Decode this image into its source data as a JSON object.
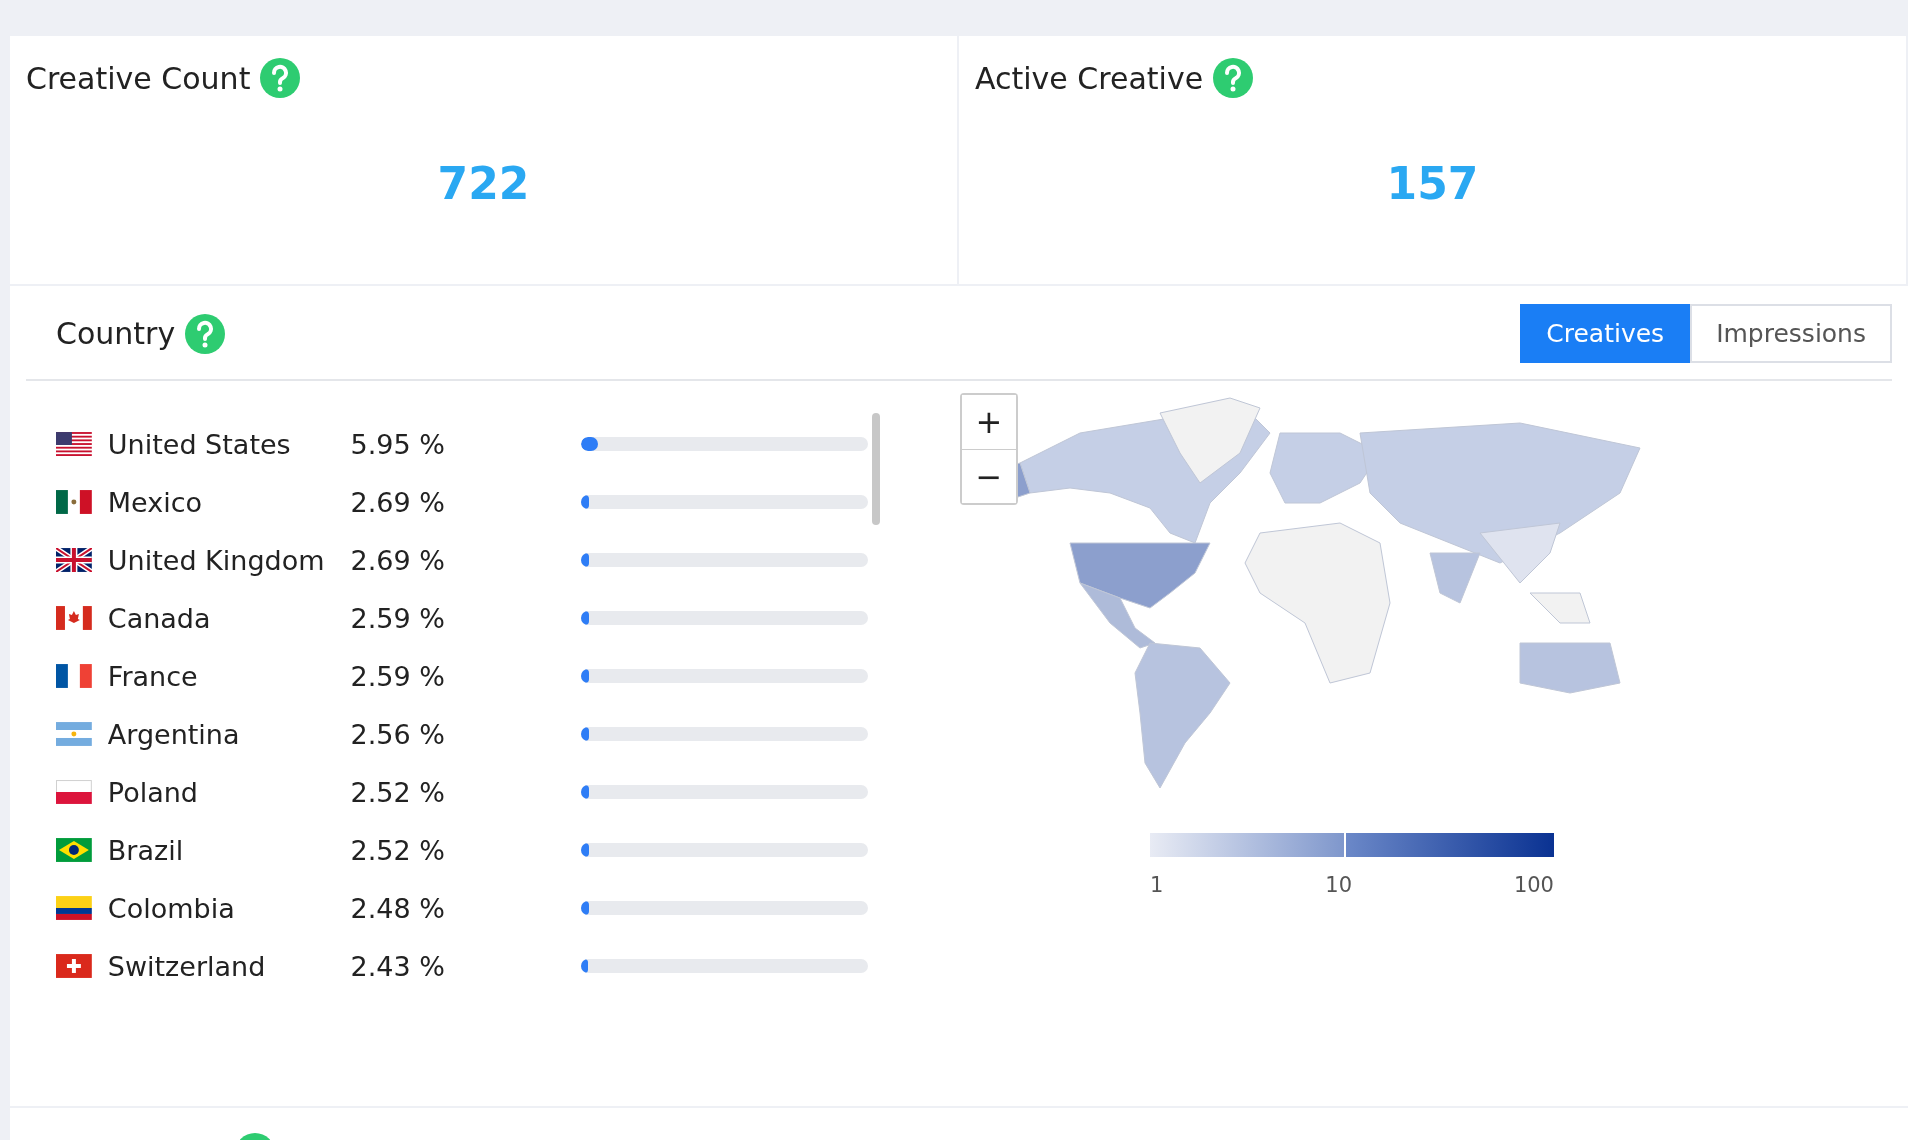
{
  "stats": [
    {
      "title": "Creative Count",
      "value": "722"
    },
    {
      "title": "Active Creative",
      "value": "157"
    }
  ],
  "country": {
    "title": "Country",
    "tabs": [
      {
        "label": "Creatives",
        "selected": true
      },
      {
        "label": "Impressions",
        "selected": false
      }
    ],
    "rows": [
      {
        "kind": "us",
        "name": "United States",
        "percent": "5.95 %",
        "level": 0.0595
      },
      {
        "kind": "mx",
        "name": "Mexico",
        "percent": "2.69 %",
        "level": 0.0269
      },
      {
        "kind": "gb",
        "name": "United Kingdom",
        "percent": "2.69 %",
        "level": 0.0269
      },
      {
        "kind": "ca",
        "name": "Canada",
        "percent": "2.59 %",
        "level": 0.0259
      },
      {
        "kind": "fr",
        "name": "France",
        "percent": "2.59 %",
        "level": 0.0259
      },
      {
        "kind": "ar",
        "name": "Argentina",
        "percent": "2.56 %",
        "level": 0.0256
      },
      {
        "kind": "pl",
        "name": "Poland",
        "percent": "2.52 %",
        "level": 0.0252
      },
      {
        "kind": "br",
        "name": "Brazil",
        "percent": "2.52 %",
        "level": 0.0252
      },
      {
        "kind": "co",
        "name": "Colombia",
        "percent": "2.48 %",
        "level": 0.0248
      },
      {
        "kind": "ch",
        "name": "Switzerland",
        "percent": "2.43 %",
        "level": 0.0243
      }
    ],
    "zoom": {
      "in": "+",
      "out": "−"
    },
    "legend": [
      "1",
      "10",
      "100"
    ]
  }
}
